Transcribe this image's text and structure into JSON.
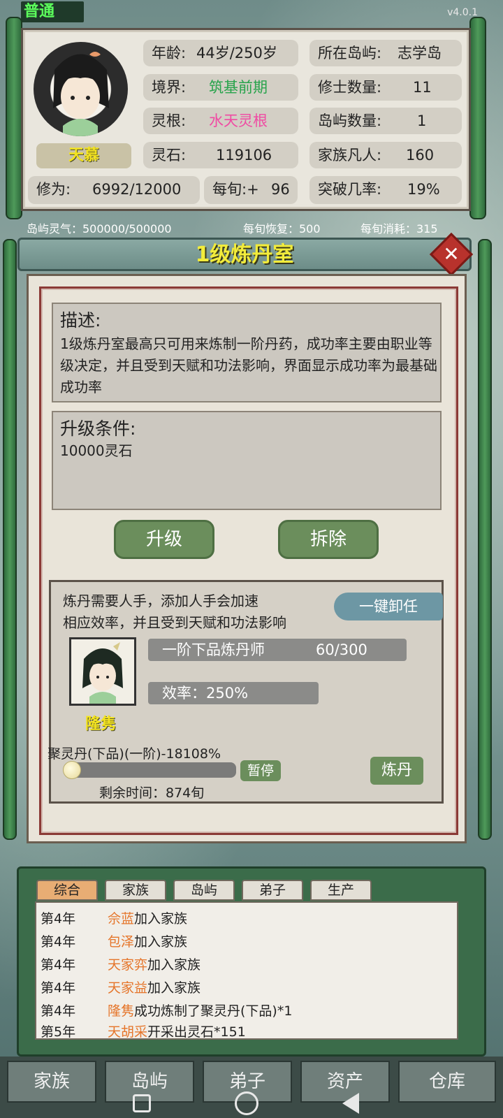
{
  "status": {
    "mode_label": "普通",
    "version": "v4.0.1"
  },
  "player": {
    "name": "天慕",
    "age_label": "年龄:",
    "age_value": "44岁/250岁",
    "realm_label": "境界:",
    "realm_value": "筑基前期",
    "root_label": "灵根:",
    "root_value": "水天灵根",
    "stones_label": "灵石:",
    "stones_value": "119106",
    "cultivation_label": "修为:",
    "cultivation_value": "6992/12000",
    "per_turn_label": "每旬:+",
    "per_turn_value": "96",
    "island_label": "所在岛屿:",
    "island_value": "志学岛",
    "cultivators_label": "修士数量:",
    "cultivators_value": "11",
    "islands_label": "岛屿数量:",
    "islands_value": "1",
    "commoners_label": "家族凡人:",
    "commoners_value": "160",
    "breakthrough_label": "突破几率:",
    "breakthrough_value": "19%"
  },
  "aura": {
    "island_aura": "岛屿灵气：500000/500000",
    "recovery": "每旬恢复：500",
    "consumption": "每旬消耗：315"
  },
  "dialog": {
    "title": "1级炼丹室",
    "desc_title": "描述:",
    "desc_text": "1级炼丹室最高只可用来炼制一阶丹药，成功率主要由职业等级决定，并且受到天赋和功法影响，界面显示成功率为最基础成功率",
    "upgrade_title": "升级条件:",
    "upgrade_text": "10000灵石",
    "upgrade_button": "升级",
    "demolish_button": "拆除",
    "worker_hint_line1": "炼丹需要人手，添加人手会加速",
    "worker_hint_line2": "相应效率，并且受到天赋和功法影响",
    "dismiss_all_button": "一键卸任",
    "worker_rank": "一阶下品炼丹师",
    "worker_exp": "60/300",
    "worker_efficiency": "效率：250%",
    "worker_name": "隆隽",
    "recipe_label": "聚灵丹(下品)(一阶)-18108%",
    "progress_fraction": 0.0,
    "pause_button": "暂停",
    "craft_button": "炼丹",
    "remaining_time": "剩余时间：874旬"
  },
  "log": {
    "tabs": [
      "综合",
      "家族",
      "岛屿",
      "弟子",
      "生产"
    ],
    "entries": [
      {
        "year": "第4年",
        "name": "佘蓝",
        "text": "加入家族"
      },
      {
        "year": "第4年",
        "name": "包泽",
        "text": "加入家族"
      },
      {
        "year": "第4年",
        "name": "天家弈",
        "text": "加入家族"
      },
      {
        "year": "第4年",
        "name": "天家益",
        "text": "加入家族"
      },
      {
        "year": "第4年",
        "name": "隆隽",
        "text": "成功炼制了聚灵丹(下品)*1"
      },
      {
        "year": "第5年",
        "name": "天胡采",
        "text": "开采出灵石*151"
      }
    ]
  },
  "nav": {
    "items": [
      "家族",
      "岛屿",
      "弟子",
      "资产",
      "仓库"
    ]
  },
  "colors": {
    "realm": "#27a34b",
    "root": "#f04aa3",
    "log_name": "#e5752a",
    "title_text": "#f2ec3b",
    "name_plate_text": "#f3e320"
  },
  "icons": {
    "close": "close-icon",
    "system_back": "triangle-back-icon",
    "system_home": "circle-home-icon",
    "system_recents": "square-recents-icon"
  }
}
